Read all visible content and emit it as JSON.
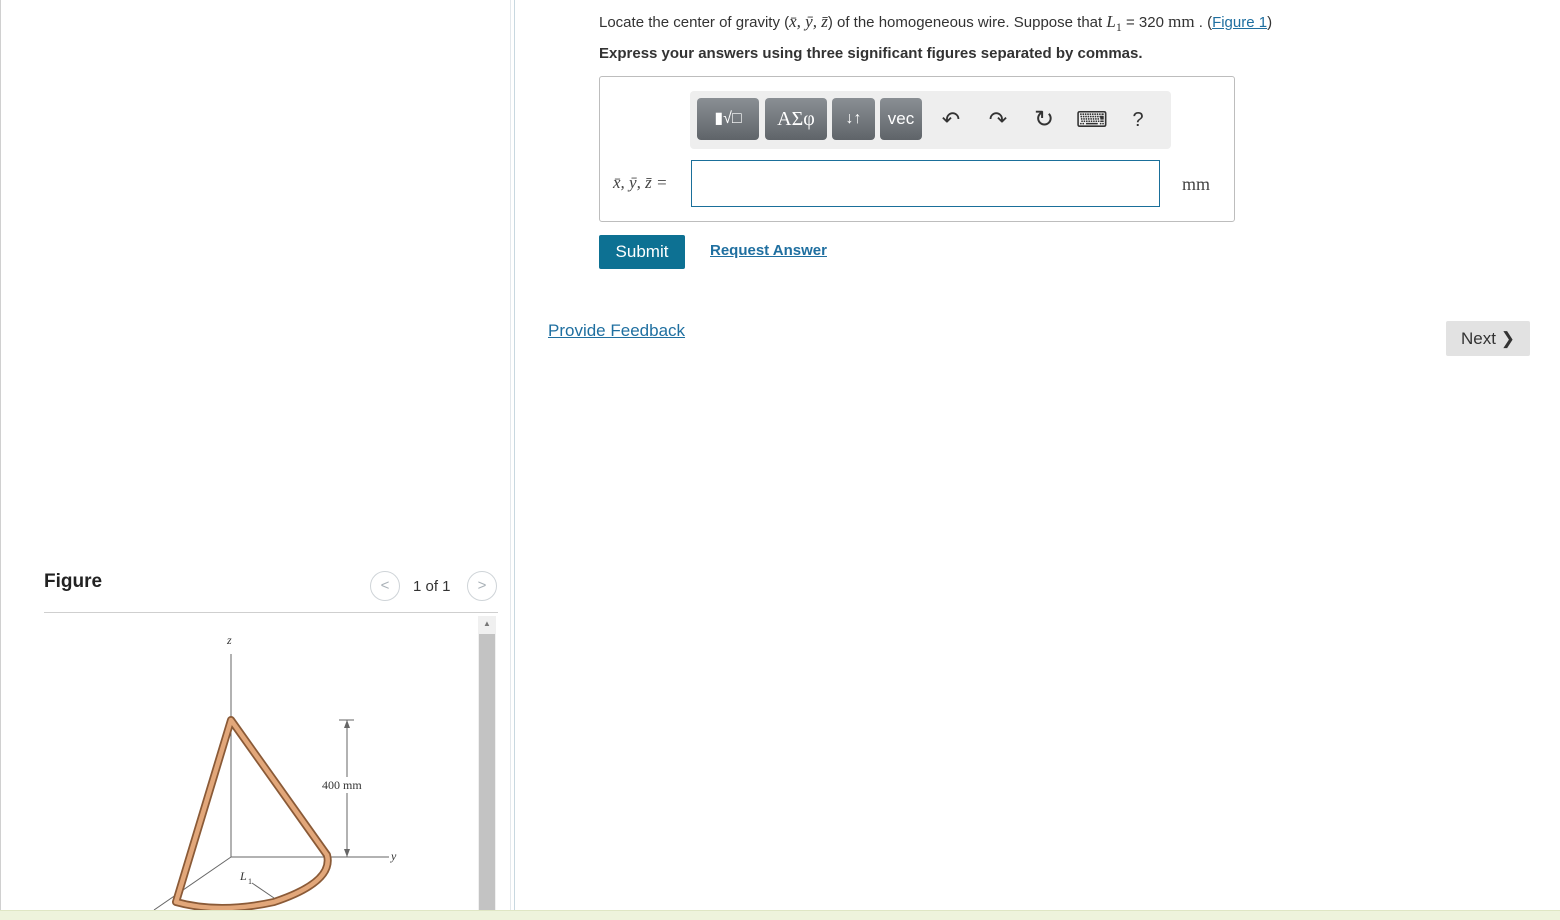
{
  "question": {
    "prefix": "Locate the center of gravity (",
    "vars": "x̄, ȳ, z̄",
    "middle": ") of the homogeneous wire. Suppose that ",
    "var_L": "L",
    "var_L_sub": "1",
    "equals_value": " = 320 ",
    "unit": "mm",
    "period": " . (",
    "figure_link": "Figure 1",
    "close": ")"
  },
  "instruction": "Express your answers using three significant figures separated by commas.",
  "toolbar": {
    "templates_label": "▮√□",
    "greek_label": "ΑΣφ",
    "arrows_label": "↓↑",
    "vec_label": "vec",
    "undo_icon": "↶",
    "redo_icon": "↷",
    "reset_icon": "↻",
    "keyboard_icon": "⌨",
    "help_label": "?"
  },
  "answer": {
    "label": "x̄, ȳ, z̄ =",
    "value": "",
    "unit": "mm"
  },
  "actions": {
    "submit": "Submit",
    "request_answer": "Request Answer",
    "provide_feedback": "Provide Feedback",
    "next": "Next ❯"
  },
  "figure_panel": {
    "title": "Figure",
    "page_indicator": "1 of 1",
    "prev_icon": "<",
    "next_icon": ">",
    "labels": {
      "z_axis": "z",
      "y_axis": "y",
      "dimension": "400 mm",
      "length": "L",
      "length_sub": "1"
    }
  }
}
